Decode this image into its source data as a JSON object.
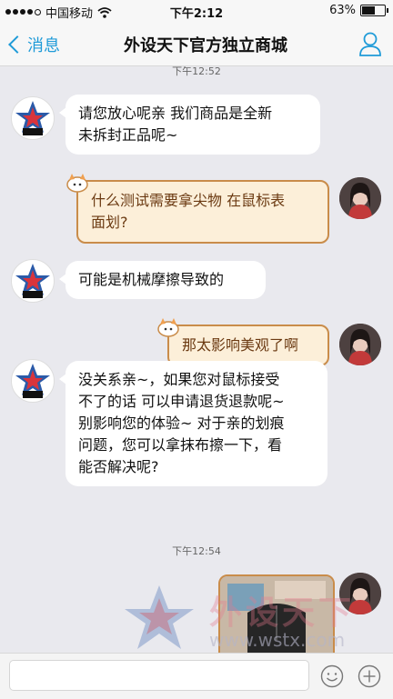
{
  "status": {
    "carrier": "中国移动",
    "time": "下午2:12",
    "battery": "63%",
    "battery_fraction": 0.63
  },
  "nav": {
    "back_label": "消息",
    "title": "外设天下官方独立商城"
  },
  "messages": [
    {
      "lines": [
        "请您放心呢亲 我们商品是全新",
        "未拆封正品呢~"
      ]
    },
    {
      "lines": [
        "什么测试需要拿尖物 在鼠标表",
        "面划?"
      ]
    },
    {
      "lines": [
        "可能是机械摩擦导致的"
      ]
    },
    {
      "lines": [
        "那太影响美观了啊"
      ]
    },
    {
      "lines": [
        "没关系亲~，如果您对鼠标接受",
        "不了的话 可以申请退货退款呢~",
        "别影响您的体验~ 对于亲的划痕",
        "问题，您可以拿抹布擦一下，看",
        "能否解决呢?"
      ]
    }
  ],
  "timestamps": {
    "top": "下午12:52",
    "middle": "下午12:54"
  },
  "watermark": {
    "brand": "外设天下",
    "url": "www.wstx.com"
  },
  "input": {
    "placeholder": ""
  },
  "icons": [
    "signal-dots-icon",
    "wifi-icon",
    "battery-icon",
    "chevron-left-icon",
    "profile-icon",
    "emoji-icon",
    "plus-icon"
  ],
  "colors": {
    "accent": "#1f9bd8",
    "bubble_out_bg": "#fcefd9",
    "bubble_out_border": "#c98c4a",
    "background": "#e9e9ee"
  }
}
